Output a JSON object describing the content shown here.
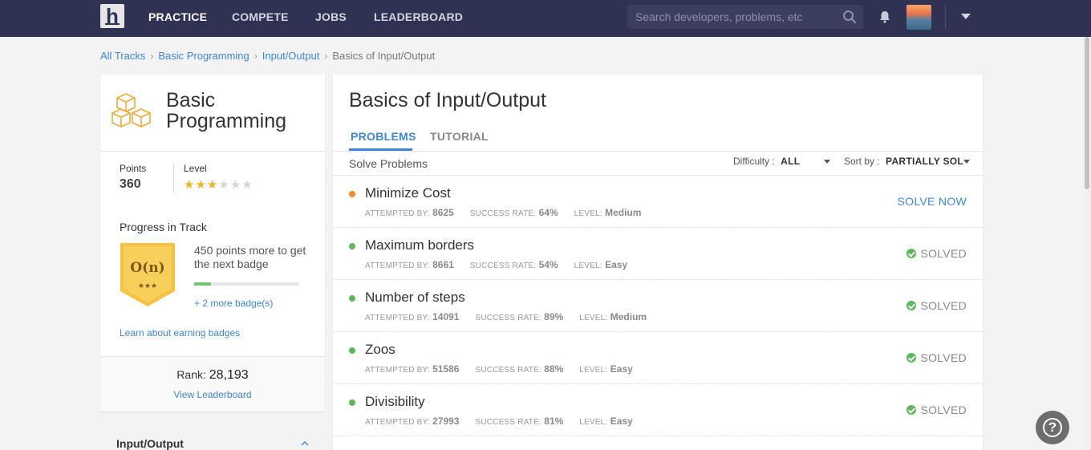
{
  "nav": {
    "logo_letter": "h",
    "links": [
      "PRACTICE",
      "COMPETE",
      "JOBS",
      "LEADERBOARD"
    ],
    "active": "PRACTICE",
    "search_placeholder": "Search developers, problems, etc"
  },
  "breadcrumb": {
    "items": [
      "All Tracks",
      "Basic Programming",
      "Input/Output"
    ],
    "current": "Basics of Input/Output",
    "separator": "›"
  },
  "track": {
    "title_line1": "Basic",
    "title_line2": "Programming",
    "points_label": "Points",
    "points_value": "360",
    "level_label": "Level",
    "level_stars": 3,
    "level_max": 6,
    "progress_title": "Progress in Track",
    "badge_glyph": "O(n)",
    "badge_stars": "★★★",
    "badge_text": "450 points more to get the next badge",
    "badge_progress": 0.16,
    "more_badges": "+ 2 more badge(s)",
    "learn_link": "Learn about earning badges",
    "rank_label": "Rank:",
    "rank_value": "28,193",
    "view_leaderboard": "View Leaderboard",
    "section_title": "Input/Output"
  },
  "main": {
    "title": "Basics of Input/Output",
    "tabs": [
      "PROBLEMS",
      "TUTORIAL"
    ],
    "solve_label": "Solve Problems",
    "difficulty_label": "Difficulty :",
    "difficulty_value": "ALL",
    "sort_label": "Sort by :",
    "sort_value": "PARTIALLY SOL",
    "meta_labels": {
      "attempted": "ATTEMPTED BY:",
      "success": "SUCCESS RATE:",
      "level": "LEVEL:"
    },
    "problems": [
      {
        "name": "Minimize Cost",
        "attempted": "8625",
        "success": "64%",
        "level": "Medium",
        "status": "SOLVE NOW",
        "solved": false,
        "dot": "#f28c28"
      },
      {
        "name": "Maximum borders",
        "attempted": "8661",
        "success": "54%",
        "level": "Easy",
        "status": "SOLVED",
        "solved": true,
        "dot": "#5cb85c"
      },
      {
        "name": "Number of steps",
        "attempted": "14091",
        "success": "89%",
        "level": "Medium",
        "status": "SOLVED",
        "solved": true,
        "dot": "#5cb85c"
      },
      {
        "name": "Zoos",
        "attempted": "51586",
        "success": "88%",
        "level": "Easy",
        "status": "SOLVED",
        "solved": true,
        "dot": "#5cb85c"
      },
      {
        "name": "Divisibility",
        "attempted": "27993",
        "success": "81%",
        "level": "Easy",
        "status": "SOLVED",
        "solved": true,
        "dot": "#5cb85c"
      }
    ]
  },
  "help": {
    "glyph": "?"
  },
  "colors": {
    "nav_bg": "#2f3253",
    "accent": "#3f86d4",
    "solved": "#5cb85c",
    "star": "#f0b429"
  }
}
